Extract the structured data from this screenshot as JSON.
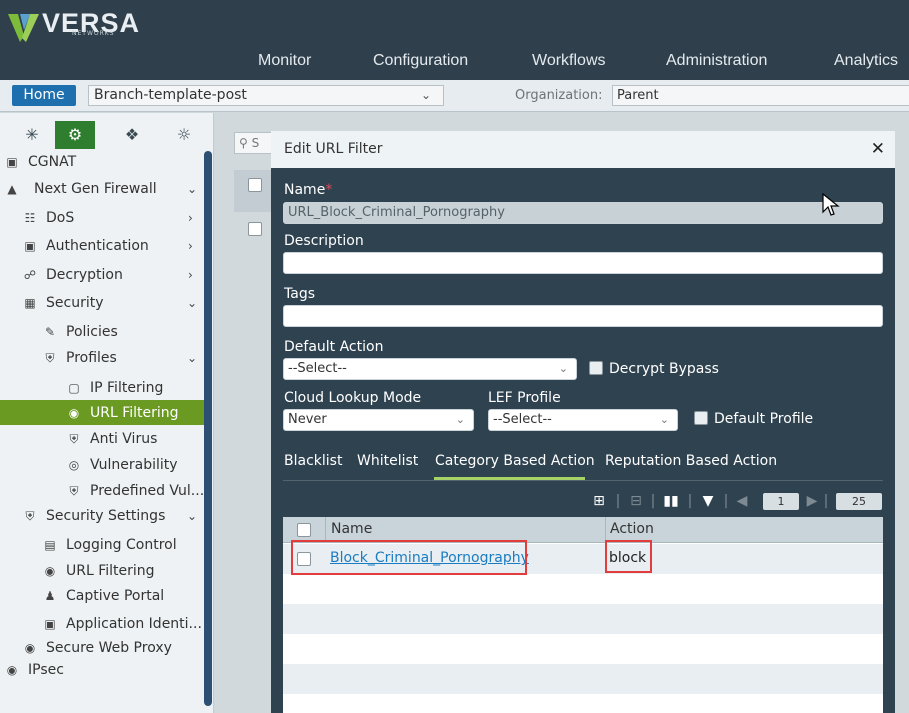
{
  "brand": {
    "name": "VERSA",
    "sub": "NETWORKS"
  },
  "nav": [
    "Monitor",
    "Configuration",
    "Workflows",
    "Administration",
    "Analytics"
  ],
  "bar": {
    "home": "Home",
    "template": "Branch-template-post",
    "org_label": "Organization:",
    "org_value": "Parent"
  },
  "sidebar": {
    "items": [
      "CGNAT",
      "Next Gen Firewall",
      "DoS",
      "Authentication",
      "Decryption",
      "Security",
      "Policies",
      "Profiles",
      "IP Filtering",
      "URL Filtering",
      "Anti Virus",
      "Vulnerability",
      "Predefined Vul...",
      "Security Settings",
      "Logging Control",
      "URL Filtering",
      "Captive Portal",
      "Application Identi...",
      "Secure Web Proxy",
      "IPsec"
    ]
  },
  "search_stub": "S",
  "modal": {
    "title": "Edit URL Filter",
    "close": "✕",
    "name_label": "Name",
    "name_required": "*",
    "name_value": "URL_Block_Criminal_Pornography",
    "description_label": "Description",
    "description_value": "",
    "tags_label": "Tags",
    "tags_value": "",
    "default_action_label": "Default Action",
    "default_action_value": "--Select--",
    "decrypt_bypass": "Decrypt Bypass",
    "cloud_lookup_label": "Cloud Lookup Mode",
    "cloud_lookup_value": "Never",
    "lef_label": "LEF Profile",
    "lef_value": "--Select--",
    "default_profile": "Default Profile",
    "tabs": [
      "Blacklist",
      "Whitelist",
      "Category Based Action",
      "Reputation Based Action"
    ],
    "pager": {
      "page": "1",
      "per_page": "25"
    },
    "grid": {
      "headers": [
        "Name",
        "Action"
      ],
      "rows": [
        {
          "name": "Block_Criminal_Pornography",
          "action": "block"
        }
      ]
    }
  }
}
